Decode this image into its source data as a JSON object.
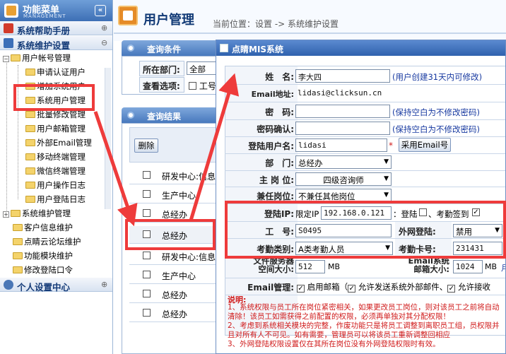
{
  "sidebar": {
    "title": "功能菜单",
    "subtitle": "MANAGEMENT",
    "collapse_glyph": "«",
    "sections": [
      {
        "label": "系统帮助手册",
        "toggle": "⊕"
      },
      {
        "label": "系统维护设置",
        "toggle": "⊖"
      }
    ],
    "tree": {
      "group1": "用户帐号管理",
      "items": [
        "申请认证用户",
        "增加系统用户",
        "系统用户管理",
        "批量修改管理",
        "用户邮箱管理",
        "外部Email管理",
        "移动终端管理",
        "微信终端管理",
        "用户操作日志",
        "用户登陆日志"
      ],
      "groups2": [
        "系统维护管理",
        "客户信息维护",
        "点睛云论坛维护",
        "功能模块维护",
        "修改登陆口令"
      ]
    },
    "personal": {
      "label": "个人设置中心",
      "toggle": "⊕"
    }
  },
  "header": {
    "title": "用户管理",
    "breadcrumb": "当前位置：设置 -> 系统维护设置"
  },
  "query": {
    "title": "查询条件",
    "dept_label": "所在部门:",
    "dept_value": "全部",
    "options_label": "查看选项:",
    "options_text": "工号"
  },
  "results": {
    "title": "查询结果",
    "delete_label": "删除",
    "rows": [
      "研发中心:信息",
      "生产中心",
      "总经办",
      "总经办",
      "研发中心:信息",
      "生产中心",
      "总经办",
      "总经办"
    ]
  },
  "dialog": {
    "title": "点睛MIS系统",
    "fields": {
      "name_label": "姓　名:",
      "name_value": "李大四",
      "name_hint": "(用户创建31天内可修改)",
      "email_label": "Email地址:",
      "email_value": "lidasi@clicksun.cn",
      "pwd_label": "密　码:",
      "pwd_hint": "(保持空白为不修改密码)",
      "pwd2_label": "密码确认:",
      "pwd2_hint": "(保持空白为不修改密码)",
      "login_label": "登陆用户名:",
      "login_value": "lidasi",
      "login_required": "*",
      "email_btn": "采用Email号",
      "dept_label": "部　门:",
      "dept_value": "总经办",
      "post_label": "主 岗 位:",
      "post_value": "四级咨询师",
      "part_label": "兼任岗位:",
      "part_value": "不兼任其他岗位",
      "ip_label": "登陆IP:",
      "ip_prefix": "限定IP",
      "ip_value": "192.168.0.121",
      "ip_login": "：登陆",
      "ip_sign": "、考勤签到",
      "empno_label": "工　号:",
      "empno_value": "S0495",
      "extlogin_label": "外网登陆:",
      "extlogin_value": "禁用",
      "att_type_label": "考勤类别:",
      "att_type_value": "A类考勤人员",
      "att_card_label": "考勤卡号:",
      "att_card_value": "231431",
      "fs_label_1": "文件服务器",
      "fs_label_2": "空间大小:",
      "fs_value": "512",
      "fs_unit": "MB",
      "mb_label_1": "Email系统",
      "mb_label_2": "邮箱大小:",
      "mb_value": "1024",
      "mb_unit": "MB",
      "mb_tail": "月",
      "emailmgmt_label": "Email管理:",
      "emailmgmt_opt1": "启用邮箱（",
      "emailmgmt_opt2": "允许发送系统外部邮件、",
      "emailmgmt_opt3": "允许接收"
    },
    "notes": {
      "title": "说明:",
      "n1": "1、系统权限与员工所在岗位紧密相关，如果更改员工岗位，则对该员工之前将自动清除！该员工如需获得之前配置的权限，必须再单独对其分配权限！",
      "n2": "2、考虑到系统相关模块的完整，作废功能只是将员工调整到离职员工组，员权限并且对所有人不可见。如有需要，管理员可以将该员工重新调整回相应",
      "n3": "3、外网登陆权限设置仅在其所在岗位没有外网登陆权限时有效。"
    }
  },
  "colors": {
    "accent_red": "#ee3b3b",
    "header_blue": "#3d6fb5",
    "hint_blue": "#1739a0"
  }
}
